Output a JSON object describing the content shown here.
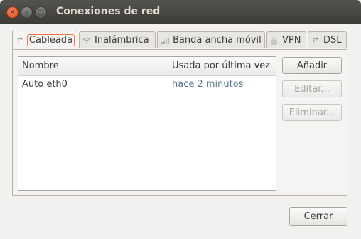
{
  "window": {
    "title": "Conexiones de red"
  },
  "tabs": [
    {
      "label": "Cableada",
      "icon": "wired-network-icon"
    },
    {
      "label": "Inalámbrica",
      "icon": "wireless-signal-icon"
    },
    {
      "label": "Banda ancha móvil",
      "icon": "mobile-signal-icon"
    },
    {
      "label": "VPN",
      "icon": "vpn-lock-icon"
    },
    {
      "label": "DSL",
      "icon": "dsl-network-icon"
    }
  ],
  "table": {
    "columns": [
      "Nombre",
      "Usada por última vez"
    ],
    "rows": [
      {
        "name": "Auto eth0",
        "last_used": "hace 2 minutos"
      }
    ]
  },
  "buttons": {
    "add": "Añadir",
    "edit": "Editar...",
    "delete": "Eliminar...",
    "close": "Cerrar"
  },
  "colors": {
    "close_button": "#dd4814",
    "active_tab_focus": "#f07746",
    "titlebar": "#3c3b37"
  }
}
